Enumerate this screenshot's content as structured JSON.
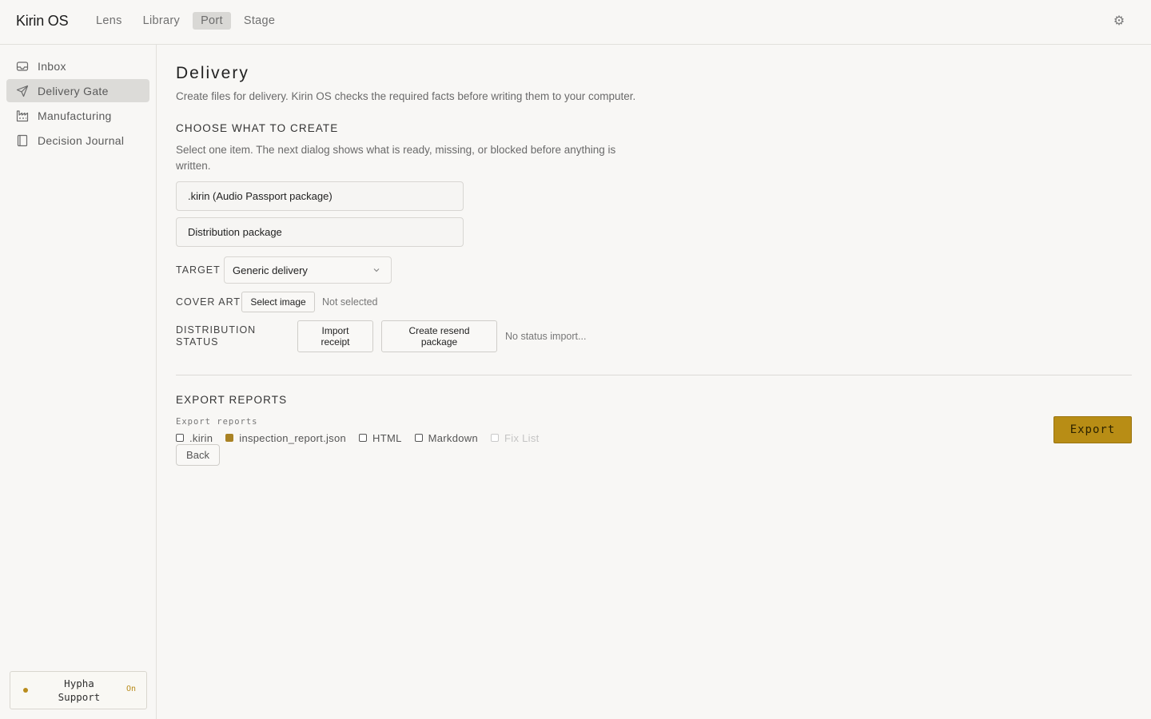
{
  "app": {
    "title": "Kirin OS"
  },
  "topnav": {
    "items": [
      {
        "label": "Lens",
        "active": false
      },
      {
        "label": "Library",
        "active": false
      },
      {
        "label": "Port",
        "active": true
      },
      {
        "label": "Stage",
        "active": false
      }
    ],
    "settings_icon": "gear-icon"
  },
  "sidebar": {
    "items": [
      {
        "label": "Inbox",
        "icon": "inbox-icon",
        "active": false
      },
      {
        "label": "Delivery Gate",
        "icon": "send-icon",
        "active": true
      },
      {
        "label": "Manufacturing",
        "icon": "factory-icon",
        "active": false
      },
      {
        "label": "Decision Journal",
        "icon": "journal-icon",
        "active": false
      }
    ],
    "support": {
      "label": "Hypha Support",
      "status": "On"
    }
  },
  "page": {
    "title": "Delivery",
    "description": "Create files for delivery. Kirin OS checks the required facts before writing them to your computer."
  },
  "create": {
    "title": "CHOOSE WHAT TO CREATE",
    "description": "Select one item. The next dialog shows what is ready, missing, or blocked before anything is written.",
    "options": [
      ".kirin (Audio Passport package)",
      "Distribution package"
    ]
  },
  "target": {
    "label": "TARGET",
    "value": "Generic delivery"
  },
  "cover_art": {
    "label": "COVER ART",
    "button": "Select image",
    "status": "Not selected"
  },
  "distribution_status": {
    "label_line1": "DISTRIBUTION",
    "label_line2": "STATUS",
    "import_line1": "Import",
    "import_line2": "receipt",
    "resend_line1": "Create resend",
    "resend_line2": "package",
    "status": "No status import..."
  },
  "export": {
    "title": "EXPORT REPORTS",
    "sub_label": "Export reports",
    "formats": [
      {
        "label": ".kirin",
        "checked": false,
        "disabled": false
      },
      {
        "label": "inspection_report.json",
        "checked": true,
        "disabled": false
      },
      {
        "label": "HTML",
        "checked": false,
        "disabled": false
      },
      {
        "label": "Markdown",
        "checked": false,
        "disabled": false
      },
      {
        "label": "Fix List",
        "checked": false,
        "disabled": true
      }
    ],
    "back_label": "Back",
    "export_label": "Export",
    "accent_color": "#b88d15"
  }
}
